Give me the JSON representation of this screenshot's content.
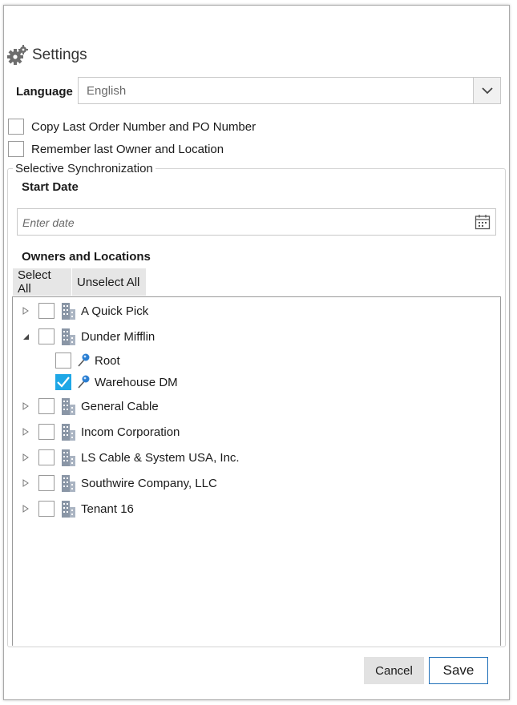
{
  "header": {
    "title": "Settings",
    "icon": "gear-icon"
  },
  "language": {
    "label": "Language",
    "value": "English"
  },
  "options": [
    {
      "label": "Copy Last Order Number and PO Number",
      "checked": false
    },
    {
      "label": "Remember last Owner and Location",
      "checked": false
    }
  ],
  "sync": {
    "group_title": "Selective Synchronization",
    "start_date_label": "Start Date",
    "date_placeholder": "Enter date",
    "owners_label": "Owners and Locations",
    "select_all": "Select All",
    "unselect_all": "Unselect All",
    "tree": [
      {
        "label": "A Quick Pick",
        "type": "owner",
        "expanded": false,
        "checked": false
      },
      {
        "label": "Dunder Mifflin",
        "type": "owner",
        "expanded": true,
        "checked": false
      },
      {
        "label": "Root",
        "type": "location",
        "checked": false
      },
      {
        "label": "Warehouse DM",
        "type": "location",
        "checked": true
      },
      {
        "label": "General Cable",
        "type": "owner",
        "expanded": false,
        "checked": false
      },
      {
        "label": "Incom Corporation",
        "type": "owner",
        "expanded": false,
        "checked": false
      },
      {
        "label": "LS Cable & System USA, Inc.",
        "type": "owner",
        "expanded": false,
        "checked": false
      },
      {
        "label": "Southwire Company, LLC",
        "type": "owner",
        "expanded": false,
        "checked": false
      },
      {
        "label": "Tenant 16",
        "type": "owner",
        "expanded": false,
        "checked": false
      }
    ]
  },
  "footer": {
    "cancel": "Cancel",
    "save": "Save"
  },
  "colors": {
    "accent": "#1ea7e6",
    "save_border": "#1f6fb8"
  }
}
